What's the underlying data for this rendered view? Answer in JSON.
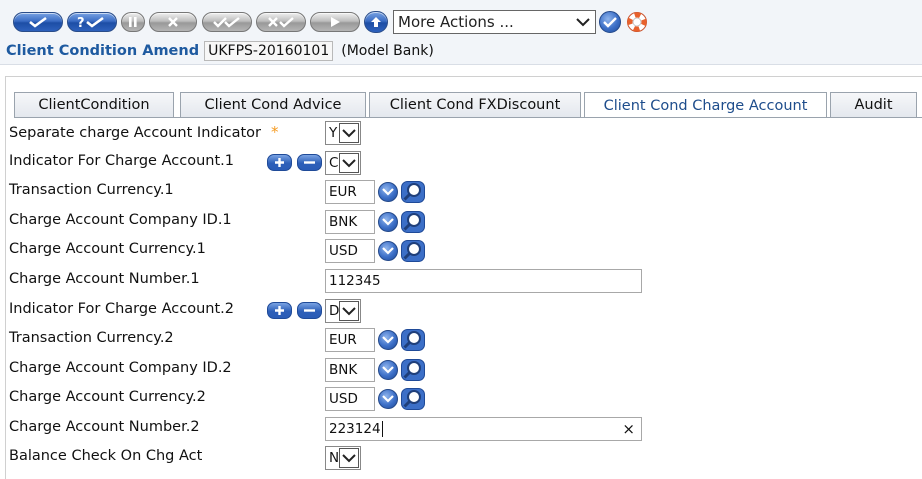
{
  "header": {
    "more_actions": "More Actions ...",
    "title": "Client Condition Amend",
    "record_id": "UKFPS-20160101",
    "company": "(Model Bank)"
  },
  "tabs": [
    {
      "label": "ClientCondition"
    },
    {
      "label": "Client Cond Advice"
    },
    {
      "label": "Client Cond FXDiscount"
    },
    {
      "label": "Client Cond Charge Account"
    },
    {
      "label": "Audit"
    }
  ],
  "fields": {
    "separate_ind": {
      "label": "Separate charge Account Indicator",
      "mandatory": "*",
      "value": "Y"
    },
    "ind_charge_1": {
      "label": "Indicator For Charge Account.1",
      "value": "C"
    },
    "txn_ccy_1": {
      "label": "Transaction Currency.1",
      "value": "EUR"
    },
    "co_id_1": {
      "label": "Charge Account Company ID.1",
      "value": "BNK"
    },
    "ca_ccy_1": {
      "label": "Charge Account Currency.1",
      "value": "USD"
    },
    "ca_num_1": {
      "label": "Charge Account Number.1",
      "value": "112345"
    },
    "ind_charge_2": {
      "label": "Indicator For Charge Account.2",
      "value": "D"
    },
    "txn_ccy_2": {
      "label": "Transaction Currency.2",
      "value": "EUR"
    },
    "co_id_2": {
      "label": "Charge Account Company ID.2",
      "value": "BNK"
    },
    "ca_ccy_2": {
      "label": "Charge Account Currency.2",
      "value": "USD"
    },
    "ca_num_2": {
      "label": "Charge Account Number.2",
      "value": "223124",
      "clear": "×"
    },
    "bal_check": {
      "label": "Balance Check On Chg Act",
      "value": "N"
    }
  },
  "colors": {
    "accent": "#1e5aa0",
    "mandatory": "#f59a1f",
    "button_blue": "#2d5fb8"
  },
  "icons": [
    "validate-icon",
    "commit-help-icon",
    "hold-icon",
    "delete-icon",
    "authorise-icon",
    "reverse-icon",
    "next-icon",
    "upload-icon",
    "go-icon",
    "help-lifebuoy-icon",
    "expand-add-icon",
    "expand-remove-icon",
    "dropdown-icon",
    "lookup-magnifier-icon"
  ]
}
